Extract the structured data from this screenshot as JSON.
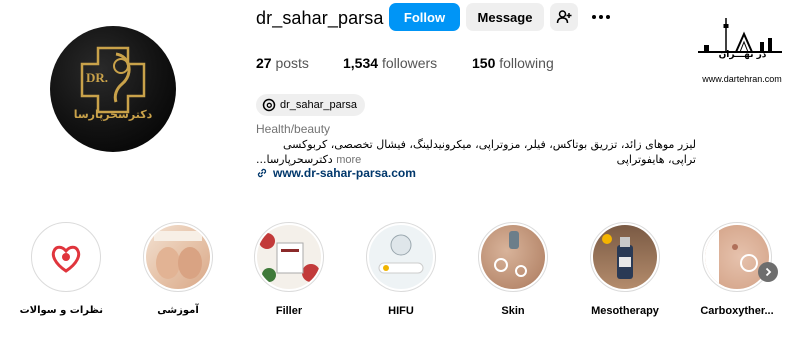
{
  "profile": {
    "username": "dr_sahar_parsa",
    "avatar_text": "دکترسحرپارسا",
    "avatar_monogram": "DR."
  },
  "actions": {
    "follow_label": "Follow",
    "message_label": "Message"
  },
  "stats": {
    "posts_count": "27",
    "posts_label": "posts",
    "followers_count": "1,534",
    "followers_label": "followers",
    "following_count": "150",
    "following_label": "following"
  },
  "threads_handle": "dr_sahar_parsa",
  "category": "Health/beauty",
  "bio": {
    "line1": "لیزر موهای زائد، تزریق بوتاکس، فیلر، مزوتراپی، میکرونیدلینگ، فیشال تخصصی، کربوکسی تراپی، هایفوتراپی",
    "line2": "...دکترسحرپارسا",
    "more_label": "more"
  },
  "website": "www.dr-sahar-parsa.com",
  "watermark": {
    "caption": "در تهـــران",
    "url": "www.dartehran.com"
  },
  "highlights": [
    {
      "label": "نظرات و سوالات",
      "rtl": true
    },
    {
      "label": "آموزشی",
      "rtl": true
    },
    {
      "label": "Filler",
      "rtl": false
    },
    {
      "label": "HIFU",
      "rtl": false
    },
    {
      "label": "Skin",
      "rtl": false
    },
    {
      "label": "Mesotherapy",
      "rtl": false
    },
    {
      "label": "Carboxyther...",
      "rtl": false
    }
  ],
  "colors": {
    "follow_button": "#0095f6",
    "secondary_button": "#efefef",
    "link": "#00376b",
    "gold": "#c9a24a"
  },
  "icons": [
    "add-user-icon",
    "more-icon",
    "threads-icon",
    "link-icon",
    "chevron-right-icon"
  ]
}
